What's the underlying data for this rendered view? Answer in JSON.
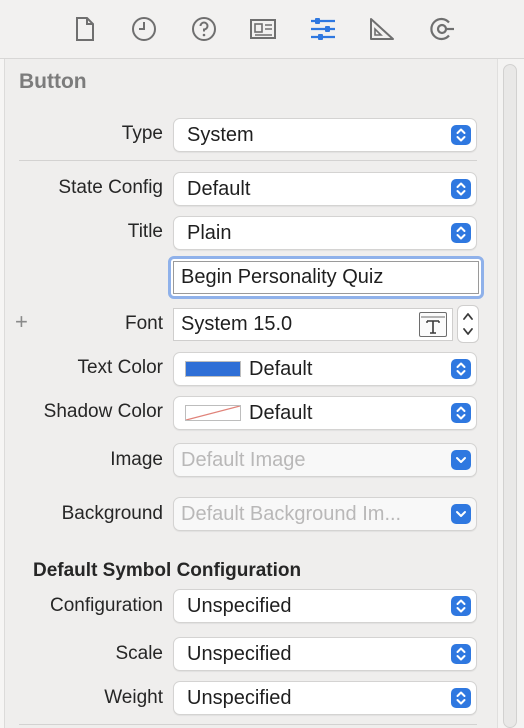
{
  "toolbar": {
    "icons": [
      "file-inspector-icon",
      "history-inspector-icon",
      "quick-help-icon",
      "identity-inspector-icon",
      "attributes-inspector-icon",
      "size-inspector-icon",
      "connections-inspector-icon"
    ],
    "active_icon": "attributes-inspector-icon",
    "accent": "#2f78e0"
  },
  "section": {
    "title": "Button"
  },
  "rows": {
    "type": {
      "label": "Type",
      "value": "System"
    },
    "state_config": {
      "label": "State Config",
      "value": "Default"
    },
    "title": {
      "label": "Title",
      "value": "Plain"
    },
    "title_text": {
      "value": "Begin Personality Quiz"
    },
    "font": {
      "label": "Font",
      "value": "System 15.0",
      "add_symbol": "+"
    },
    "text_color": {
      "label": "Text Color",
      "value": "Default",
      "swatch": "#2f6fd6"
    },
    "shadow_color": {
      "label": "Shadow Color",
      "value": "Default"
    },
    "image": {
      "label": "Image",
      "placeholder": "Default Image"
    },
    "background": {
      "label": "Background",
      "placeholder": "Default Background Im..."
    }
  },
  "symbol_config": {
    "title": "Default Symbol Configuration",
    "configuration": {
      "label": "Configuration",
      "value": "Unspecified"
    },
    "scale": {
      "label": "Scale",
      "value": "Unspecified"
    },
    "weight": {
      "label": "Weight",
      "value": "Unspecified"
    }
  }
}
